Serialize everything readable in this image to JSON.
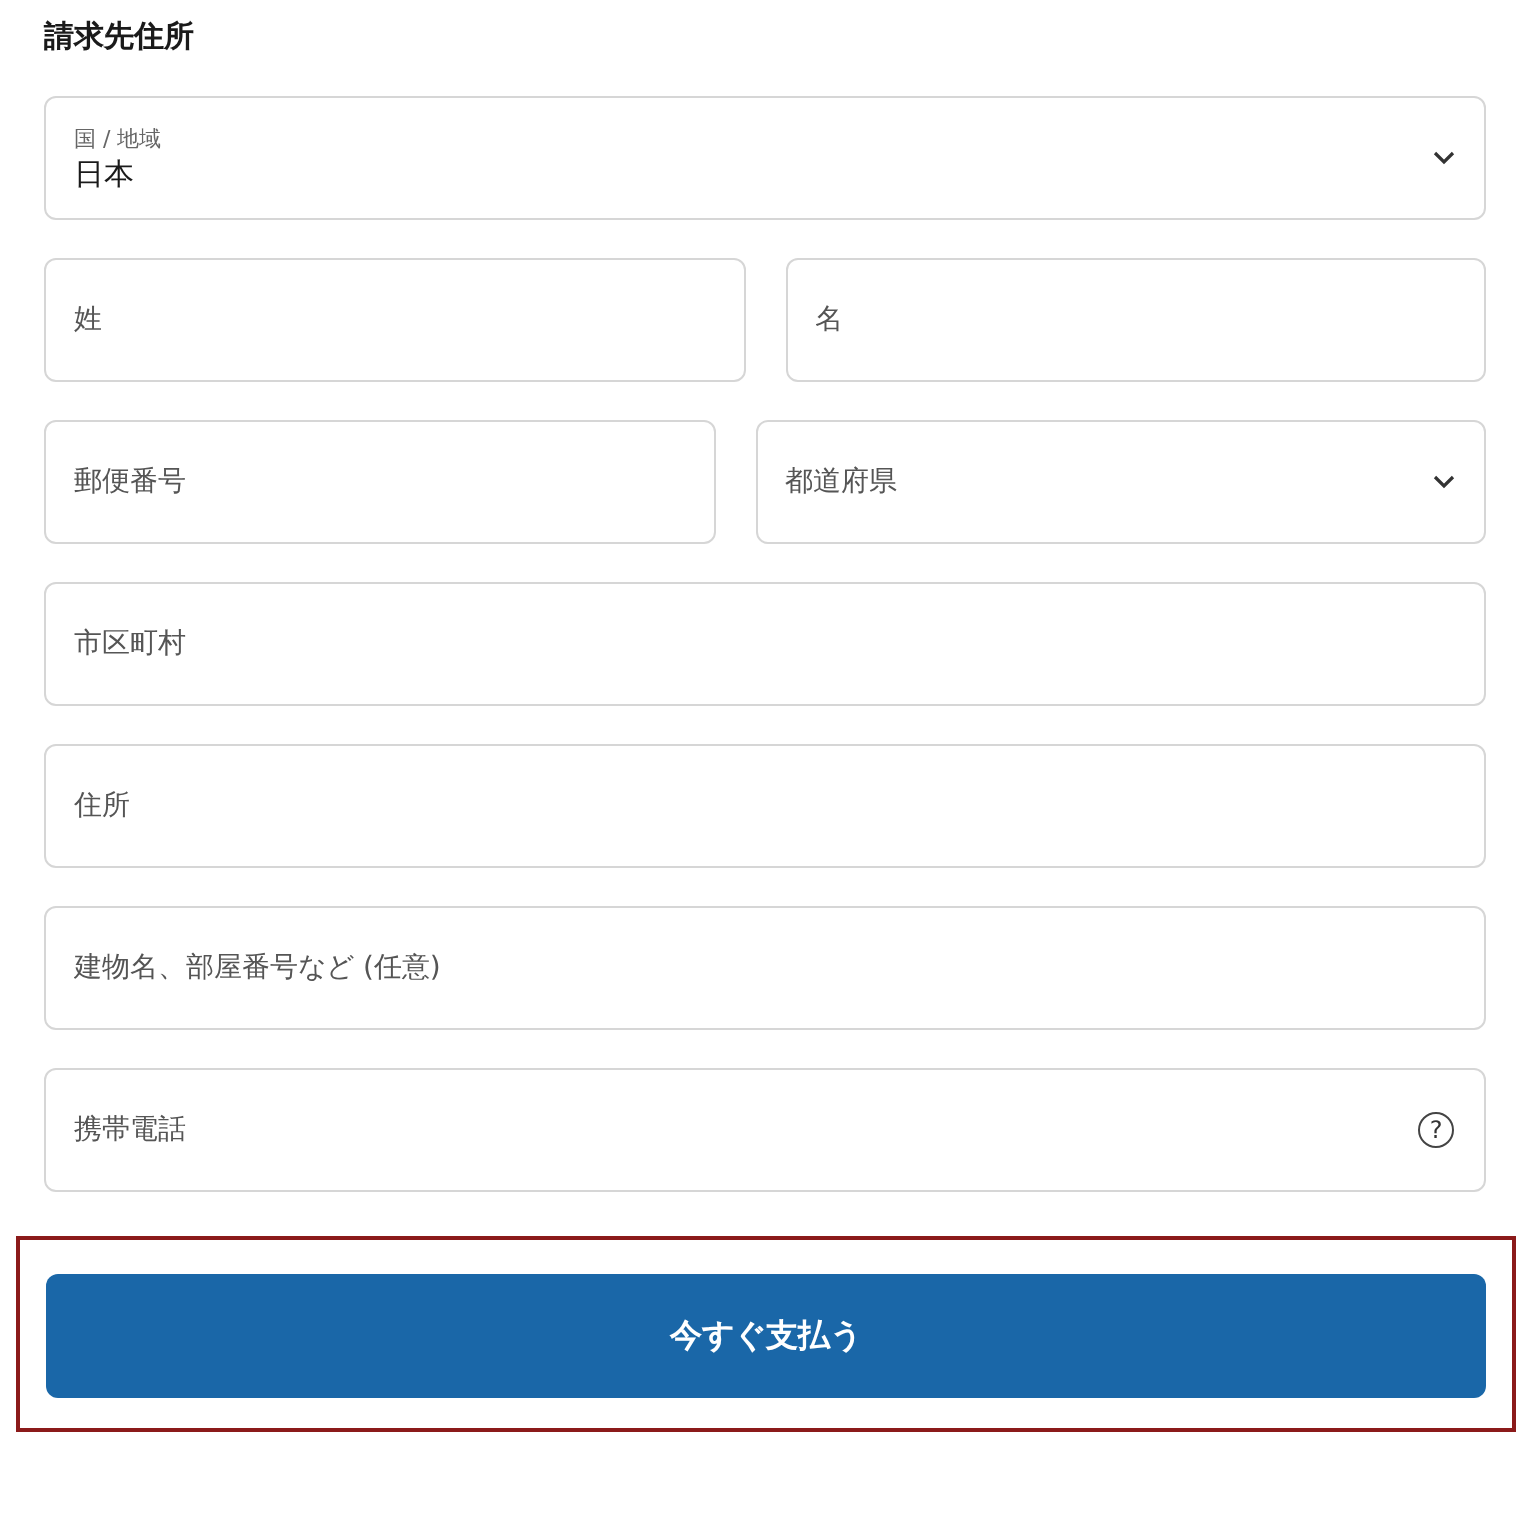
{
  "section_title": "請求先住所",
  "rows": [
    [
      {
        "kind": "select",
        "label": "国 / 地域",
        "value": "日本"
      }
    ],
    [
      {
        "kind": "text",
        "placeholder": "姓"
      },
      {
        "kind": "text",
        "placeholder": "名"
      }
    ],
    [
      {
        "kind": "text",
        "placeholder": "郵便番号"
      },
      {
        "kind": "select",
        "placeholder": "都道府県"
      }
    ],
    [
      {
        "kind": "text",
        "placeholder": "市区町村"
      }
    ],
    [
      {
        "kind": "text",
        "placeholder": "住所"
      }
    ],
    [
      {
        "kind": "text",
        "placeholder": "建物名、部屋番号など (任意)"
      }
    ],
    [
      {
        "kind": "phone",
        "placeholder": "携帯電話",
        "help": "?"
      }
    ]
  ],
  "pay_button": {
    "label": "今すぐ支払う",
    "highlighted": true
  }
}
